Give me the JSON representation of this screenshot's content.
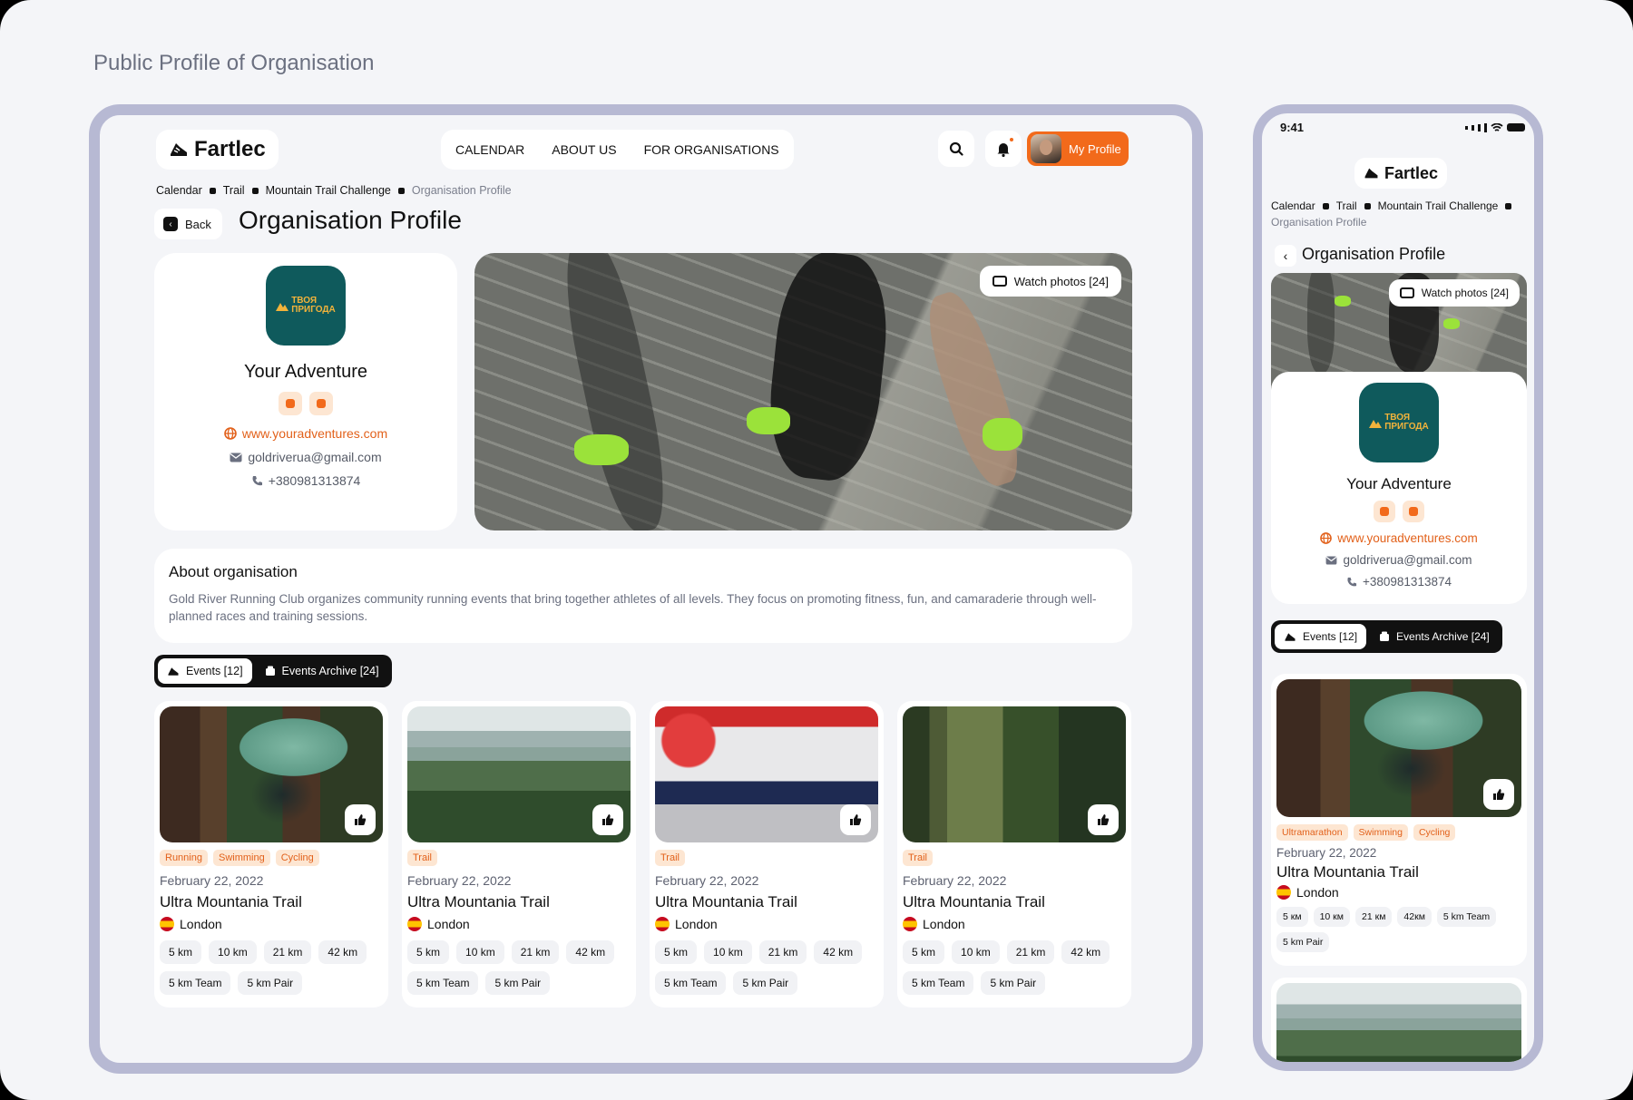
{
  "page_heading": "Public Profile of Organisation",
  "brand": {
    "name": "Fartlec"
  },
  "nav": {
    "items": [
      "CALENDAR",
      "ABOUT US",
      "FOR ORGANISATIONS"
    ],
    "my_profile": "My Profile"
  },
  "breadcrumb": {
    "items": [
      "Calendar",
      "Trail",
      "Mountain Trail Challenge"
    ],
    "current": "Organisation Profile"
  },
  "back_label": "Back",
  "title": "Organisation Profile",
  "org": {
    "logo_text_1": "ТВОЯ",
    "logo_text_2": "ПРИГОДА",
    "name": "Your Adventure",
    "website": "www.youradventures.com",
    "email": "goldriverua@gmail.com",
    "phone": "+380981313874"
  },
  "hero": {
    "watch_label": "Watch photos [24]"
  },
  "about": {
    "heading": "About organisation",
    "text": "Gold River Running Club organizes community running events that bring together athletes of all levels. They focus on promoting fitness, fun, and camaraderie through well-planned races and training sessions."
  },
  "tabs": {
    "events": "Events [12]",
    "archive": "Events Archive [24]"
  },
  "events": [
    {
      "tags": [
        "Running",
        "Swimming",
        "Cycling"
      ],
      "date": "February 22, 2022",
      "name": "Ultra Mountania Trail",
      "location": "London",
      "distances": [
        "5 km",
        "10 km",
        "21 km",
        "42 km",
        "5 km Team",
        "5 km Pair"
      ]
    },
    {
      "tags": [
        "Trail"
      ],
      "date": "February 22, 2022",
      "name": "Ultra Mountania Trail",
      "location": "London",
      "distances": [
        "5 km",
        "10 km",
        "21 km",
        "42 km",
        "5 km Team",
        "5 km Pair"
      ]
    },
    {
      "tags": [
        "Trail"
      ],
      "date": "February 22, 2022",
      "name": "Ultra Mountania Trail",
      "location": "London",
      "distances": [
        "5 km",
        "10 km",
        "21 km",
        "42 km",
        "5 km Team",
        "5 km Pair"
      ]
    },
    {
      "tags": [
        "Trail"
      ],
      "date": "February 22, 2022",
      "name": "Ultra Mountania Trail",
      "location": "London",
      "distances": [
        "5 km",
        "10 km",
        "21 km",
        "42 km",
        "5 km Team",
        "5 km Pair"
      ]
    }
  ],
  "mobile": {
    "time": "9:41",
    "event": {
      "tags": [
        "Ultramarathon",
        "Swimming",
        "Cycling"
      ],
      "date": "February 22, 2022",
      "name": "Ultra Mountania Trail",
      "location": "London",
      "distances": [
        "5 км",
        "10 км",
        "21 км",
        "42км",
        "5 km Team",
        "5 km Pair"
      ]
    }
  },
  "colors": {
    "accent": "#f26a1b",
    "frame": "#b7b9d3",
    "org_logo_bg": "#0f5a5c",
    "tag_bg": "#fde6d2"
  }
}
